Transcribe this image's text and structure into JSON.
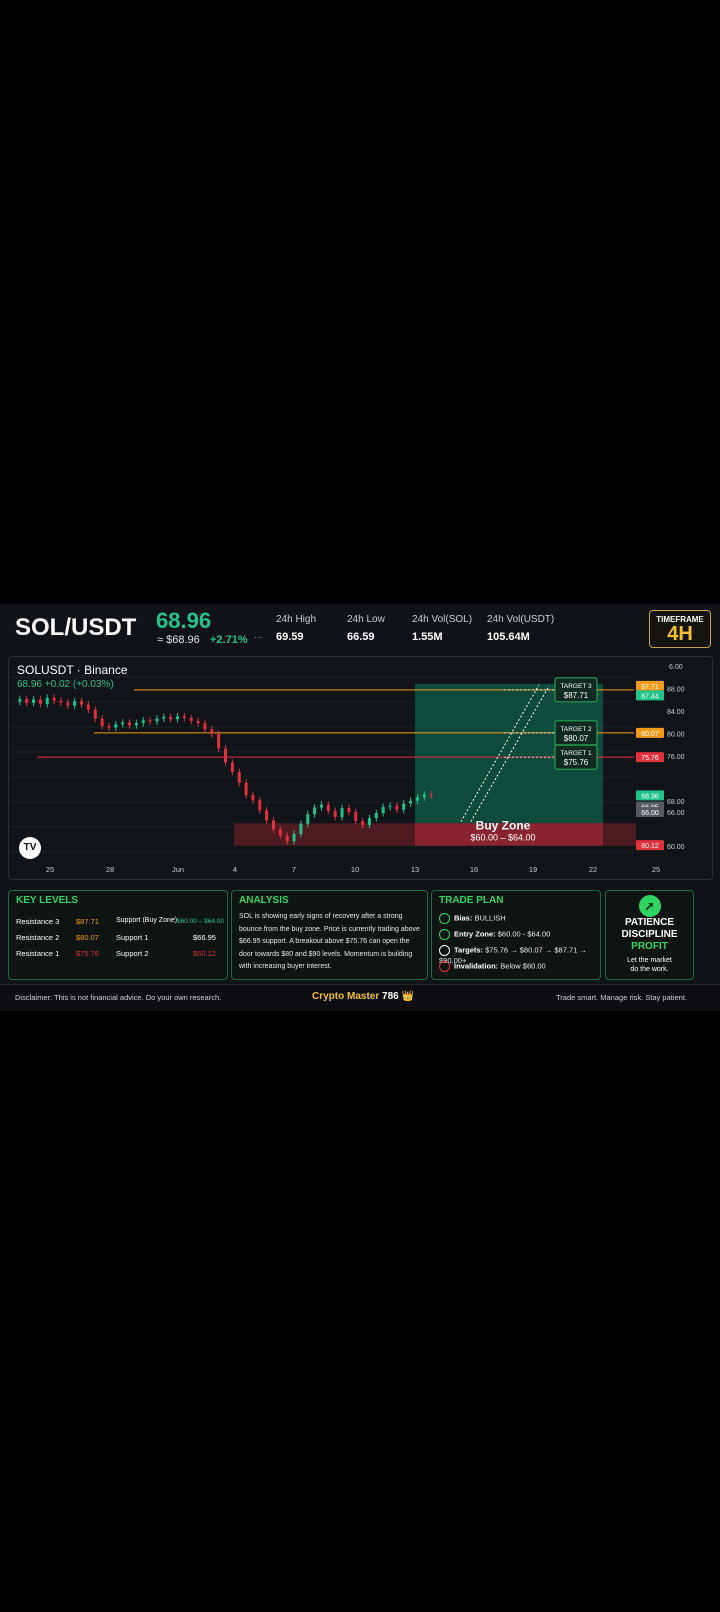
{
  "header": {
    "pair": "SOL/USDT",
    "price": "68.96",
    "usd_price": "≈ $68.96",
    "change": "+2.71%",
    "more": "...",
    "stats": [
      {
        "label": "24h High",
        "value": "69.59"
      },
      {
        "label": "24h Low",
        "value": "66.59"
      },
      {
        "label": "24h Vol(SOL)",
        "value": "1.55M"
      },
      {
        "label": "24h Vol(USDT)",
        "value": "105.64M"
      }
    ],
    "timeframe_label": "TIMEFRAME",
    "timeframe_value": "4H"
  },
  "chart": {
    "title": "SOLUSDT · Binance",
    "subtitle": "68.96 +0.02 (+0.03%)",
    "logo": "TV",
    "buy_zone_title": "Buy Zone",
    "buy_zone_range": "$60.00 – $64.00",
    "top_right": "6.00"
  },
  "colors": {
    "green": "#22c38a",
    "red": "#e0303c",
    "orange": "#f29a1a",
    "gold": "#f2c12e",
    "zone_green": "#0d5e49",
    "zone_red": "#7d1f27"
  },
  "chart_data": {
    "type": "line",
    "x_tick_labels": [
      "25",
      "28",
      "Jun",
      "4",
      "7",
      "10",
      "13",
      "16",
      "19",
      "22",
      "25"
    ],
    "y_tick_labels": [
      "88.00",
      "84.00",
      "80.00",
      "76.00",
      "68.00",
      "66.00",
      "60.00"
    ],
    "ylim": [
      58,
      90
    ],
    "series": [
      {
        "values": [
          85.6,
          86.1,
          85.4,
          86.0,
          85.2,
          86.3,
          85.8,
          85.5,
          84.9,
          85.7,
          85.1,
          84.2,
          82.6,
          81.3,
          81.0,
          81.6,
          81.9,
          81.4,
          81.8,
          82.3,
          82.1,
          82.6,
          82.9,
          82.5,
          83.0,
          82.7,
          82.2,
          81.8,
          80.7,
          79.9,
          77.3,
          74.8,
          73.1,
          71.2,
          69.0,
          68.1,
          66.3,
          64.5,
          62.9,
          61.8,
          60.8,
          62.1,
          63.9,
          65.6,
          66.8,
          67.3,
          66.2,
          65.1,
          66.7,
          66.0,
          64.4,
          63.7,
          64.9,
          65.8,
          66.9,
          67.1,
          66.4,
          67.5,
          68.0,
          68.6,
          69.1,
          68.96
        ]
      }
    ],
    "levels": [
      {
        "label": "87.71",
        "value": 87.71,
        "color": "#f29a1a"
      },
      {
        "label": "87.44",
        "value": 87.44,
        "color": "#22c38a"
      },
      {
        "label": "80.07",
        "value": 80.07,
        "color": "#f29a1a"
      },
      {
        "label": "75.76",
        "value": 75.76,
        "color": "#e0303c"
      },
      {
        "label": "68.96",
        "value": 68.96,
        "color": "#22c38a"
      },
      {
        "label": "66.95",
        "value": 66.95,
        "color": "#555b61"
      },
      {
        "label": "66.00",
        "value": 66.0,
        "color": "#555b61"
      },
      {
        "label": "60.12",
        "value": 60.12,
        "color": "#e0303c"
      }
    ],
    "targets": [
      {
        "name": "TARGET 3",
        "value": "$87.71",
        "level": 87.71
      },
      {
        "name": "TARGET 2",
        "value": "$80.07",
        "level": 80.07
      },
      {
        "name": "TARGET 1",
        "value": "$75.76",
        "level": 75.76
      }
    ],
    "buy_zone": [
      60.0,
      64.0
    ]
  },
  "key_levels": {
    "title": "KEY LEVELS",
    "rows": [
      {
        "res_label": "Resistance 3",
        "res_value": "$87.71",
        "sup_label": "Support (Buy Zone)",
        "sup_value": "$60.00 – $64.00"
      },
      {
        "res_label": "Resistance 2",
        "res_value": "$80.07",
        "sup_label": "Support 1",
        "sup_value": "$66.95"
      },
      {
        "res_label": "Resistance 1",
        "res_value": "$75.76",
        "sup_label": "Support 2",
        "sup_value": "$60.12"
      }
    ]
  },
  "analysis": {
    "title": "ANALYSIS",
    "text": "SOL is showing early signs of recovery after a strong bounce from the buy zone. Price is currently trading above $66.95 support. A breakout above $75.76 can open the door towards $80 and $90 levels. Momentum is building with increasing buyer interest."
  },
  "trade_plan": {
    "title": "TRADE PLAN",
    "items": [
      {
        "label": "Bias:",
        "value": "BULLISH"
      },
      {
        "label": "Entry Zone:",
        "value": "$60.00 - $64.00"
      },
      {
        "label": "Targets:",
        "value": "$75.76 → $80.07 → $87.71 → $90.00+"
      },
      {
        "label": "Invalidation:",
        "value": "Below $60.00"
      }
    ]
  },
  "motto": {
    "w1": "PATIENCE",
    "w2": "DISCIPLINE",
    "w3": "PROFIT",
    "sub1": "Let the market",
    "sub2": "do the work."
  },
  "footer": {
    "disclaimer": "Disclaimer: This is not financial advice. Do your own research.",
    "brand": "Crypto Master",
    "brand_num": "786 👑",
    "tagline": "Trade smart. Manage risk. Stay patient."
  }
}
